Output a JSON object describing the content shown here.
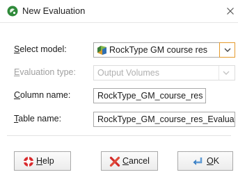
{
  "window": {
    "title": "New Evaluation",
    "icon": "evaluation-app-icon",
    "close_icon": "close-icon"
  },
  "form": {
    "select_model": {
      "label": "Select model:",
      "mnemonic": "S",
      "label_rest": "elect model:",
      "value": "RockType GM course res",
      "icon": "geological-model-icon",
      "dropdown_icon": "chevron-down-icon"
    },
    "evaluation_type": {
      "label": "Evaluation type:",
      "mnemonic": "E",
      "label_rest": "valuation type:",
      "value": "Output Volumes",
      "disabled": true
    },
    "column_name": {
      "label": "Column name:",
      "mnemonic": "C",
      "label_rest": "olumn name:",
      "value": "RockType_GM_course_res"
    },
    "table_name": {
      "label": "Table name:",
      "mnemonic": "T",
      "label_rest": "able name:",
      "value": "RockType_GM_course_res_Evaluat"
    }
  },
  "buttons": {
    "help": {
      "label": "Help",
      "mnemonic": "H",
      "label_rest": "elp",
      "icon": "help-lifebuoy-icon"
    },
    "cancel": {
      "label": "Cancel",
      "mnemonic": "C",
      "label_rest": "ancel",
      "icon": "cancel-x-icon"
    },
    "ok": {
      "label": "OK",
      "mnemonic": "O",
      "label_rest": "K",
      "icon": "ok-return-arrow-icon"
    }
  },
  "colors": {
    "focus_border": "#e59a2c",
    "app_icon_green": "#2f8a3a"
  }
}
